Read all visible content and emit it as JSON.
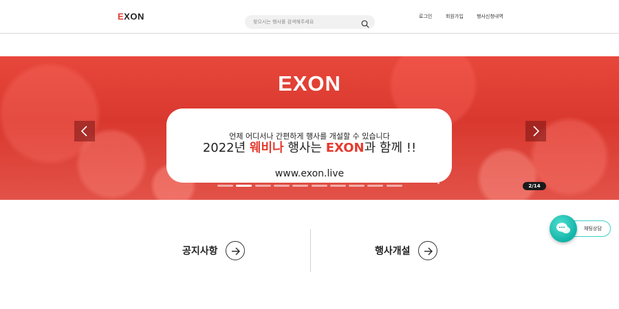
{
  "header": {
    "logo_prefix": "E",
    "logo_rest": "XON",
    "search_placeholder": "찾으시는 행사를 검색해주세요",
    "nav": {
      "login": "로그인",
      "signup": "회원가입",
      "event_history": "행사신청내역"
    }
  },
  "banner": {
    "logo": "EXON",
    "line1": "언제 어디서나 간편하게 행사를 개설할 수 있습니다",
    "line2_a": "2022년 ",
    "line2_highlight": "웨비나",
    "line2_b": " 행사는 ",
    "line2_brand": "EXON",
    "line2_c": "과 함께 !!",
    "url": "www.exon.live",
    "slide_counter": "2/14",
    "dot_count": 10,
    "active_dot": 1
  },
  "links": {
    "notice": "공지사항",
    "create_event": "행사개설"
  },
  "chat": {
    "label": "채팅상담"
  },
  "colors": {
    "brand_red": "#e53a2f",
    "chat_teal": "#12b3a8"
  }
}
